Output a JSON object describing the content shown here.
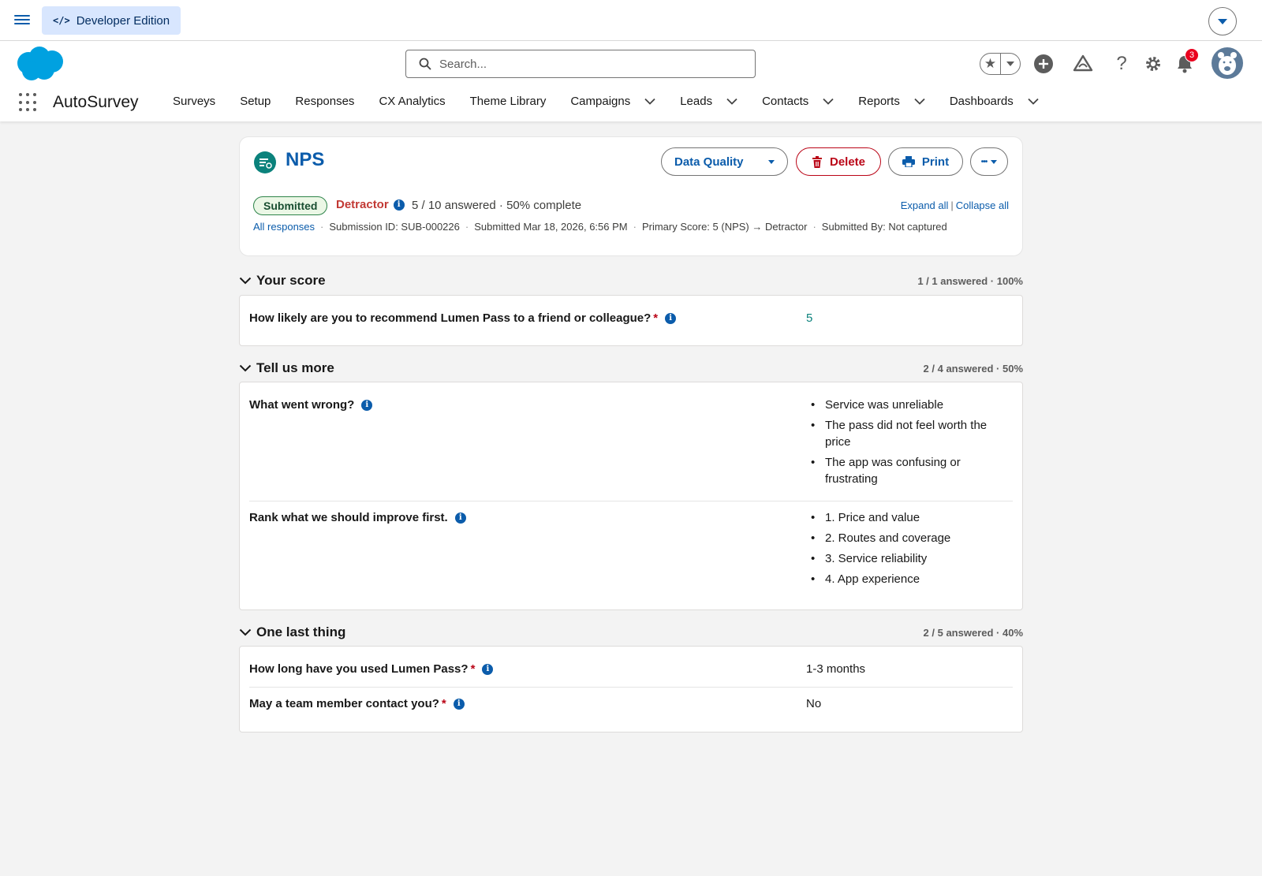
{
  "topbar": {
    "edition_label": "Developer Edition"
  },
  "header": {
    "search_placeholder": "Search...",
    "notification_count": "3",
    "app_name": "AutoSurvey",
    "nav": [
      {
        "label": "Surveys",
        "dropdown": false
      },
      {
        "label": "Setup",
        "dropdown": false
      },
      {
        "label": "Responses",
        "dropdown": false
      },
      {
        "label": "CX Analytics",
        "dropdown": false
      },
      {
        "label": "Theme Library",
        "dropdown": false
      },
      {
        "label": "Campaigns",
        "dropdown": true
      },
      {
        "label": "Leads",
        "dropdown": true
      },
      {
        "label": "Contacts",
        "dropdown": true
      },
      {
        "label": "Reports",
        "dropdown": true
      },
      {
        "label": "Dashboards",
        "dropdown": true
      }
    ]
  },
  "record": {
    "title": "NPS",
    "buttons": {
      "data_quality": "Data Quality",
      "delete": "Delete",
      "print": "Print",
      "more": "•••"
    },
    "status": "Submitted",
    "category": "Detractor",
    "progress": "5 / 10 answered · 50% complete",
    "expand_all": "Expand all",
    "collapse_all": "Collapse all",
    "meta": {
      "all_responses": "All responses",
      "submission_id": "Submission ID: SUB-000226",
      "submitted": "Submitted Mar 18, 2026, 6:56 PM",
      "primary_score": "Primary Score: 5 (NPS) → Detractor",
      "submitted_by": "Submitted By: Not captured"
    }
  },
  "sections": [
    {
      "title": "Your score",
      "count": "1 / 1 answered · 100%",
      "questions": [
        {
          "label": "How likely are you to recommend Lumen Pass to a friend or colleague?",
          "required": true,
          "answer": "5"
        }
      ]
    },
    {
      "title": "Tell us more",
      "count": "2 / 4 answered · 50%",
      "questions": [
        {
          "label": "What went wrong?",
          "required": false,
          "answers": [
            "Service was unreliable",
            "The pass did not feel worth the price",
            "The app was confusing or frustrating"
          ]
        },
        {
          "label": "Rank what we should improve first.",
          "required": false,
          "answers": [
            "1. Price and value",
            "2. Routes and coverage",
            "3. Service reliability",
            "4. App experience"
          ]
        }
      ]
    },
    {
      "title": "One last thing",
      "count": "2 / 5 answered · 40%",
      "questions": [
        {
          "label": "How long have you used Lumen Pass?",
          "required": true,
          "answer": "1-3 months"
        },
        {
          "label": "May a team member contact you?",
          "required": true,
          "answer": "No"
        }
      ]
    }
  ],
  "colors": {
    "brand": "#0b5cab",
    "delete": "#ba0517",
    "detractor": "#c23934",
    "submitted_bg": "#ebf7e6",
    "page_bg": "#f3f3f3"
  }
}
